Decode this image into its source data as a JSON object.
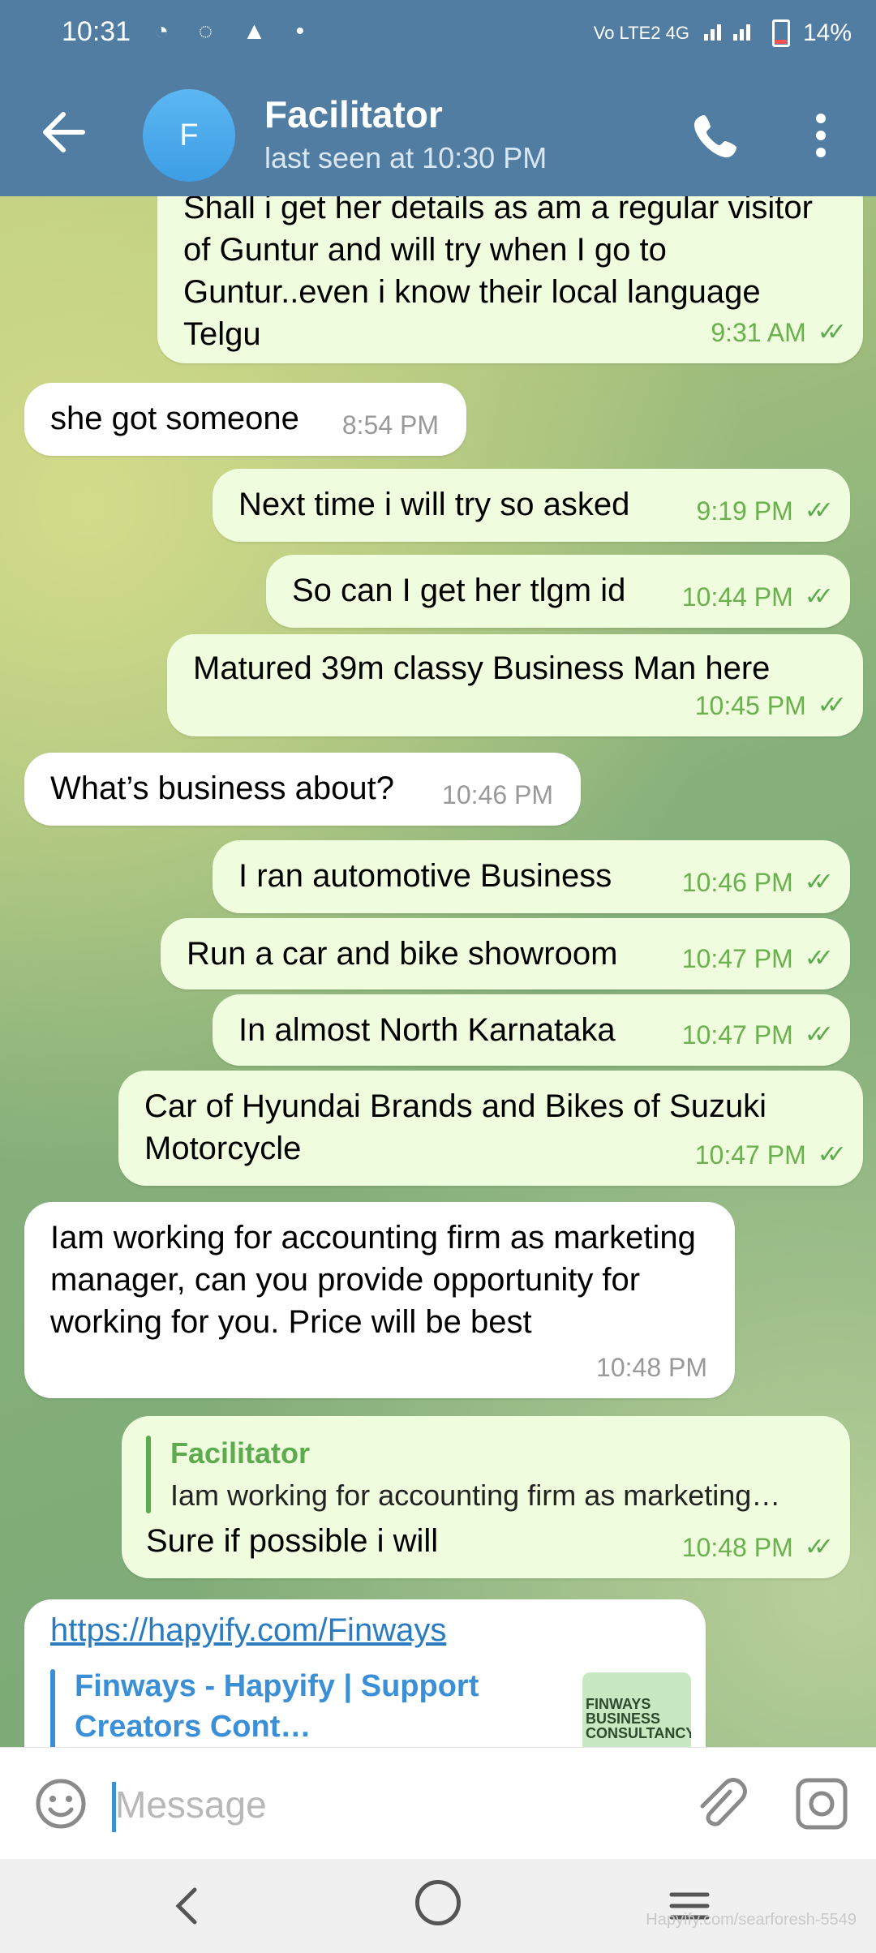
{
  "status": {
    "time": "10:31",
    "left_icons": "◔ ◌ ▲ •",
    "network": "Vo LTE2 4G",
    "battery": "14%"
  },
  "header": {
    "avatar_letter": "F",
    "title": "Facilitator",
    "subtitle": "last seen at 10:30 PM"
  },
  "messages": [
    {
      "type": "out",
      "text": "Shall i get her details as am a regular visitor of Guntur and will try when I go to Guntur..even i know their local language Telgu",
      "time": "9:31 AM"
    },
    {
      "type": "in",
      "text": "she got someone",
      "time": "8:54 PM"
    },
    {
      "type": "out",
      "text": "Next time i will try so asked",
      "time": "9:19 PM"
    },
    {
      "type": "out",
      "text": "So can I get her tlgm id",
      "time": "10:44 PM"
    },
    {
      "type": "out",
      "text": "Matured 39m classy Business Man here",
      "time": "10:45 PM"
    },
    {
      "type": "in",
      "text": "What’s business about?",
      "time": "10:46 PM"
    },
    {
      "type": "out",
      "text": "I ran  automotive Business",
      "time": "10:46 PM"
    },
    {
      "type": "out",
      "text": "Run a car and bike showroom",
      "time": "10:47 PM"
    },
    {
      "type": "out",
      "text": "In almost North Karnataka",
      "time": "10:47 PM"
    },
    {
      "type": "out",
      "text": "Car of Hyundai Brands and Bikes of Suzuki Motorcycle",
      "time": "10:47 PM"
    },
    {
      "type": "in",
      "text": "Iam working for accounting firm as marketing manager, can you provide opportunity for working for you. Price will be best",
      "time": "10:48 PM"
    },
    {
      "type": "out",
      "reply_name": "Facilitator",
      "reply_text": "Iam working for accounting firm as marketing…",
      "text": "Sure if possible i will",
      "time": "10:48 PM"
    },
    {
      "type": "in",
      "link": "https://hapyify.com/Finways",
      "preview_title": "Finways - Hapyify | Support Creators Cont…",
      "thumb_text": "FINWAYS BUSINESS CONSULTANCY"
    }
  ],
  "input": {
    "placeholder": "Message"
  },
  "watermark": "Hapyify.com/searforesh-5549",
  "colors": {
    "header": "#517da2",
    "out_bubble": "#effdde",
    "in_bubble": "#ffffff",
    "accent": "#5eab4f"
  }
}
